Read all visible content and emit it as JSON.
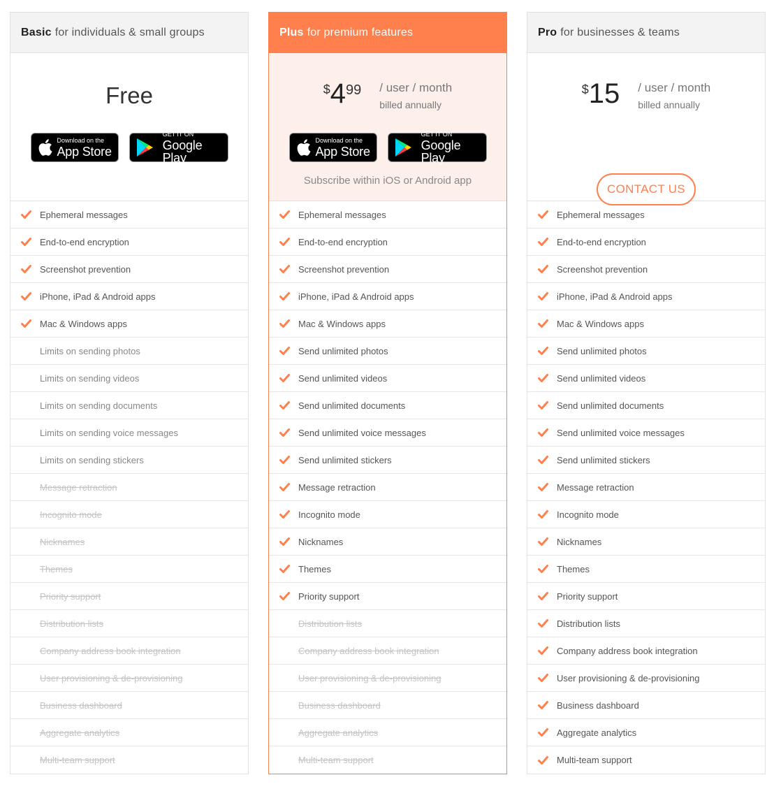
{
  "colors": {
    "accent": "#ff7f4d",
    "plus_tint": "#fdf0eb",
    "header_gray": "#f3f3f3"
  },
  "plans": [
    {
      "id": "basic",
      "name": "Basic",
      "tagline": "for individuals & small groups",
      "price_label": "Free",
      "apple_badge": {
        "small": "Download on the",
        "big": "App Store"
      },
      "google_badge": {
        "small": "GET IT ON",
        "big": "Google Play"
      },
      "features": [
        {
          "label": "Ephemeral messages",
          "status": "included"
        },
        {
          "label": "End-to-end encryption",
          "status": "included"
        },
        {
          "label": "Screenshot prevention",
          "status": "included"
        },
        {
          "label": "iPhone, iPad & Android apps",
          "status": "included"
        },
        {
          "label": "Mac & Windows apps",
          "status": "included"
        },
        {
          "label": "Limits on sending photos",
          "status": "limited"
        },
        {
          "label": "Limits on sending videos",
          "status": "limited"
        },
        {
          "label": "Limits on sending documents",
          "status": "limited"
        },
        {
          "label": "Limits on sending voice messages",
          "status": "limited"
        },
        {
          "label": "Limits on sending stickers",
          "status": "limited"
        },
        {
          "label": "Message retraction",
          "status": "excluded"
        },
        {
          "label": "Incognito mode",
          "status": "excluded"
        },
        {
          "label": "Nicknames",
          "status": "excluded"
        },
        {
          "label": "Themes",
          "status": "excluded"
        },
        {
          "label": "Priority support",
          "status": "excluded"
        },
        {
          "label": "Distribution lists",
          "status": "excluded"
        },
        {
          "label": "Company address book integration",
          "status": "excluded"
        },
        {
          "label": "User provisioning & de-provisioning",
          "status": "excluded"
        },
        {
          "label": "Business dashboard",
          "status": "excluded"
        },
        {
          "label": "Aggregate analytics",
          "status": "excluded"
        },
        {
          "label": "Multi-team support",
          "status": "excluded"
        }
      ]
    },
    {
      "id": "plus",
      "name": "Plus",
      "tagline": "for premium features",
      "price": {
        "currency": "$",
        "amount": "4",
        "cents": "99",
        "unit": "/ user / month",
        "billing": "billed annually"
      },
      "apple_badge": {
        "small": "Download on the",
        "big": "App Store"
      },
      "google_badge": {
        "small": "GET IT ON",
        "big": "Google Play"
      },
      "note": "Subscribe within iOS or Android app",
      "features": [
        {
          "label": "Ephemeral messages",
          "status": "included"
        },
        {
          "label": "End-to-end encryption",
          "status": "included"
        },
        {
          "label": "Screenshot prevention",
          "status": "included"
        },
        {
          "label": "iPhone, iPad & Android apps",
          "status": "included"
        },
        {
          "label": "Mac & Windows apps",
          "status": "included"
        },
        {
          "label": "Send unlimited photos",
          "status": "included"
        },
        {
          "label": "Send unlimited videos",
          "status": "included"
        },
        {
          "label": "Send unlimited documents",
          "status": "included"
        },
        {
          "label": "Send unlimited voice messages",
          "status": "included"
        },
        {
          "label": "Send unlimited stickers",
          "status": "included"
        },
        {
          "label": "Message retraction",
          "status": "included"
        },
        {
          "label": "Incognito mode",
          "status": "included"
        },
        {
          "label": "Nicknames",
          "status": "included"
        },
        {
          "label": "Themes",
          "status": "included"
        },
        {
          "label": "Priority support",
          "status": "included"
        },
        {
          "label": "Distribution lists",
          "status": "excluded"
        },
        {
          "label": "Company address book integration",
          "status": "excluded"
        },
        {
          "label": "User provisioning & de-provisioning",
          "status": "excluded"
        },
        {
          "label": "Business dashboard",
          "status": "excluded"
        },
        {
          "label": "Aggregate analytics",
          "status": "excluded"
        },
        {
          "label": "Multi-team support",
          "status": "excluded"
        }
      ]
    },
    {
      "id": "pro",
      "name": "Pro",
      "tagline": "for businesses & teams",
      "price": {
        "currency": "$",
        "amount": "15",
        "cents": "",
        "unit": "/ user / month",
        "billing": "billed annually"
      },
      "cta_label": "CONTACT US",
      "features": [
        {
          "label": "Ephemeral messages",
          "status": "included"
        },
        {
          "label": "End-to-end encryption",
          "status": "included"
        },
        {
          "label": "Screenshot prevention",
          "status": "included"
        },
        {
          "label": "iPhone, iPad & Android apps",
          "status": "included"
        },
        {
          "label": "Mac & Windows apps",
          "status": "included"
        },
        {
          "label": "Send unlimited photos",
          "status": "included"
        },
        {
          "label": "Send unlimited videos",
          "status": "included"
        },
        {
          "label": "Send unlimited documents",
          "status": "included"
        },
        {
          "label": "Send unlimited voice messages",
          "status": "included"
        },
        {
          "label": "Send unlimited stickers",
          "status": "included"
        },
        {
          "label": "Message retraction",
          "status": "included"
        },
        {
          "label": "Incognito mode",
          "status": "included"
        },
        {
          "label": "Nicknames",
          "status": "included"
        },
        {
          "label": "Themes",
          "status": "included"
        },
        {
          "label": "Priority support",
          "status": "included"
        },
        {
          "label": "Distribution lists",
          "status": "included"
        },
        {
          "label": "Company address book integration",
          "status": "included"
        },
        {
          "label": "User provisioning & de-provisioning",
          "status": "included"
        },
        {
          "label": "Business dashboard",
          "status": "included"
        },
        {
          "label": "Aggregate analytics",
          "status": "included"
        },
        {
          "label": "Multi-team support",
          "status": "included"
        }
      ]
    }
  ]
}
